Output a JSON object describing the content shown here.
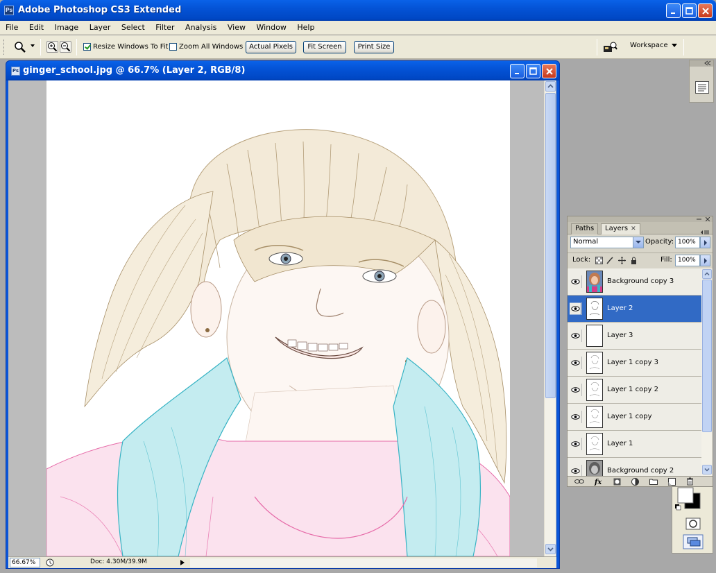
{
  "app": {
    "title": "Adobe Photoshop CS3 Extended",
    "logo": "Ps"
  },
  "menu": [
    "File",
    "Edit",
    "Image",
    "Layer",
    "Select",
    "Filter",
    "Analysis",
    "View",
    "Window",
    "Help"
  ],
  "options": {
    "resize_windows": {
      "label": "Resize Windows To Fit",
      "checked": true
    },
    "zoom_all": {
      "label": "Zoom All Windows",
      "checked": false
    },
    "actual_pixels": "Actual Pixels",
    "fit_screen": "Fit Screen",
    "print_size": "Print Size",
    "workspace": "Workspace"
  },
  "document": {
    "title": "ginger_school.jpg @ 66.7% (Layer 2, RGB/8)",
    "logo": "Ps",
    "zoom": "66.67%",
    "doc_info": "Doc: 4.30M/39.9M"
  },
  "layers_panel": {
    "tabs": [
      {
        "label": "Paths",
        "active": false
      },
      {
        "label": "Layers",
        "active": true
      }
    ],
    "blend_mode": "Normal",
    "opacity_label": "Opacity:",
    "opacity_value": "100%",
    "lock_label": "Lock:",
    "fill_label": "Fill:",
    "fill_value": "100%",
    "layers": [
      {
        "name": "Background copy 3",
        "visible": true,
        "selected": false,
        "thumb": "photo"
      },
      {
        "name": "Layer 2",
        "visible": true,
        "selected": true,
        "thumb": "sketch"
      },
      {
        "name": "Layer 3",
        "visible": true,
        "selected": false,
        "thumb": "blank"
      },
      {
        "name": "Layer 1 copy 3",
        "visible": true,
        "selected": false,
        "thumb": "sketch"
      },
      {
        "name": "Layer 1 copy 2",
        "visible": true,
        "selected": false,
        "thumb": "sketch"
      },
      {
        "name": "Layer 1 copy",
        "visible": true,
        "selected": false,
        "thumb": "sketch"
      },
      {
        "name": "Layer 1",
        "visible": true,
        "selected": false,
        "thumb": "sketch"
      },
      {
        "name": "Background copy 2",
        "visible": true,
        "selected": false,
        "thumb": "gray"
      }
    ]
  },
  "colors": {
    "xp_title": "#0453d6",
    "selection": "#316ac5",
    "chrome": "#ece9d8"
  }
}
